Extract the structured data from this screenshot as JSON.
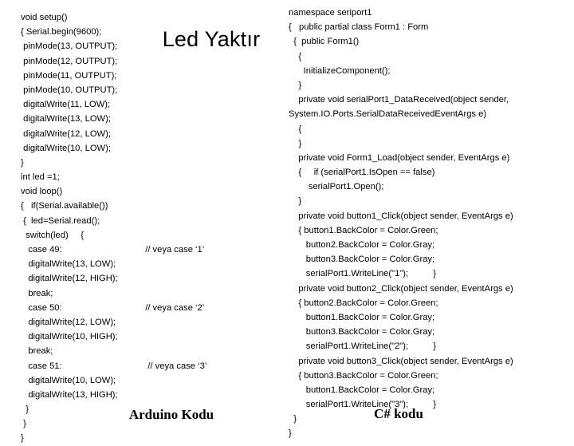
{
  "slide": {
    "title": "Led Yaktır",
    "background_color": "#ffffff",
    "text_color": "#000000"
  },
  "arduino": {
    "caption": "Arduino Kodu",
    "lines": [
      {
        "code": "void setup()",
        "comment": ""
      },
      {
        "code": "{ Serial.begin(9600);",
        "comment": ""
      },
      {
        "code": " pinMode(13, OUTPUT);",
        "comment": ""
      },
      {
        "code": " pinMode(12, OUTPUT);",
        "comment": ""
      },
      {
        "code": " pinMode(11, OUTPUT);",
        "comment": ""
      },
      {
        "code": " pinMode(10, OUTPUT);",
        "comment": ""
      },
      {
        "code": " digitalWrite(11, LOW);",
        "comment": ""
      },
      {
        "code": " digitalWrite(13, LOW);",
        "comment": ""
      },
      {
        "code": " digitalWrite(12, LOW);",
        "comment": ""
      },
      {
        "code": " digitalWrite(10, LOW);",
        "comment": ""
      },
      {
        "code": "}",
        "comment": ""
      },
      {
        "code": "int led =1;",
        "comment": ""
      },
      {
        "code": "void loop()",
        "comment": ""
      },
      {
        "code": "{   if(Serial.available())",
        "comment": ""
      },
      {
        "code": " {  led=Serial.read();",
        "comment": ""
      },
      {
        "code": "  switch(led)     {",
        "comment": ""
      },
      {
        "code": "   case 49:",
        "comment": "// veya case ‘1’"
      },
      {
        "code": "   digitalWrite(13, LOW);",
        "comment": ""
      },
      {
        "code": "   digitalWrite(12, HIGH);",
        "comment": ""
      },
      {
        "code": "   break;",
        "comment": ""
      },
      {
        "code": "   case 50:",
        "comment": "// veya case ‘2’"
      },
      {
        "code": "   digitalWrite(12, LOW);",
        "comment": ""
      },
      {
        "code": "   digitalWrite(10, HIGH);",
        "comment": ""
      },
      {
        "code": "   break;",
        "comment": ""
      },
      {
        "code": "   case 51:",
        "comment": " // veya case ‘3’"
      },
      {
        "code": "   digitalWrite(10, LOW);",
        "comment": ""
      },
      {
        "code": "   digitalWrite(13, HIGH);",
        "comment": ""
      },
      {
        "code": "  }",
        "comment": ""
      },
      {
        "code": " }",
        "comment": ""
      },
      {
        "code": "}",
        "comment": ""
      }
    ]
  },
  "csharp": {
    "caption": "C# kodu",
    "lines": [
      "namespace seriport1",
      "{   public partial class Form1 : Form",
      "  {  public Form1()",
      "    {",
      "      InitializeComponent();",
      "    }",
      "    private void serialPort1_DataReceived(object sender,",
      "System.IO.Ports.SerialDataReceivedEventArgs e)",
      "    {",
      "    }",
      "    private void Form1_Load(object sender, EventArgs e)",
      "    {     if (serialPort1.IsOpen == false)",
      "        serialPort1.Open();",
      "    }",
      "    private void button1_Click(object sender, EventArgs e)",
      "    { button1.BackColor = Color.Green;",
      "       button2.BackColor = Color.Gray;",
      "       button3.BackColor = Color.Gray;",
      "       serialPort1.WriteLine(\"1\");          }",
      "    private void button2_Click(object sender, EventArgs e)",
      "    { button2.BackColor = Color.Green;",
      "       button1.BackColor = Color.Gray;",
      "       button3.BackColor = Color.Gray;",
      "       serialPort1.WriteLine(\"2\");          }",
      "    private void button3_Click(object sender, EventArgs e)",
      "    { button3.BackColor = Color.Green;",
      "       button1.BackColor = Color.Gray;",
      "       serialPort1.WriteLine(\"3\");          }",
      "  }",
      "}"
    ]
  }
}
